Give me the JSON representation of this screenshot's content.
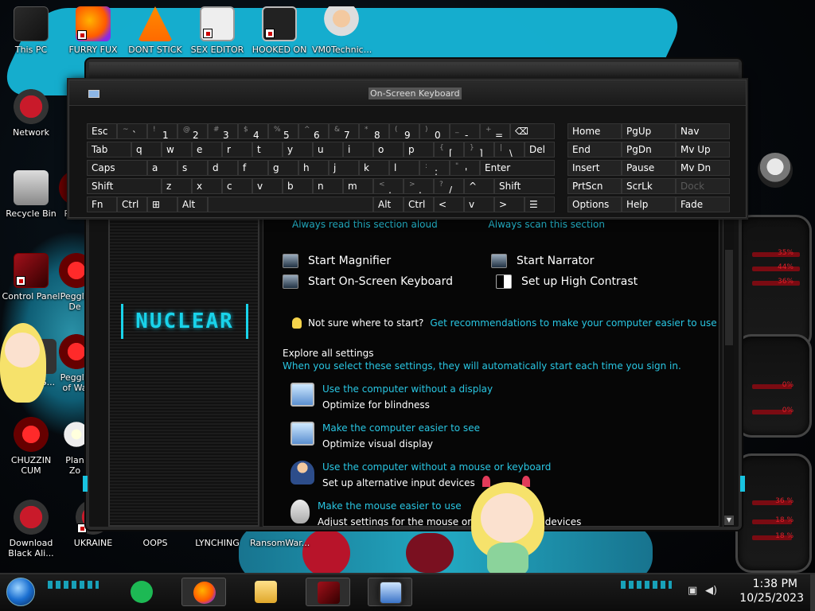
{
  "desktop": {
    "icons": [
      {
        "label": "This PC"
      },
      {
        "label": "FURRY FUX"
      },
      {
        "label": "DONT STICK"
      },
      {
        "label": "SEX EDITOR"
      },
      {
        "label": "HOOKED ON"
      },
      {
        "label": "VM0Technic..."
      },
      {
        "label": "Network"
      },
      {
        "label": "Recycle Bin"
      },
      {
        "label": "Pegg"
      },
      {
        "label": "Control Panel"
      },
      {
        "label": "Peggle De"
      },
      {
        "label": "TS..."
      },
      {
        "label": "Peggle of Wa"
      },
      {
        "label": "CHUZZIN CUM"
      },
      {
        "label": "Plan Zo"
      },
      {
        "label": "Download Black Ali..."
      },
      {
        "label": "UKRAINE"
      },
      {
        "label": "OOPS"
      },
      {
        "label": "LYNCHING"
      },
      {
        "label": "RansomWar..."
      }
    ]
  },
  "hud": {
    "percents": [
      "35%",
      "44%",
      "36%",
      "0%",
      "0%",
      "36 %",
      "18 %",
      "18 %"
    ]
  },
  "ease_window": {
    "logo": "NUCLEAR",
    "checkbox_read": "Always read this section aloud",
    "checkbox_scan": "Always scan this section",
    "quick_tools": {
      "magnifier": "Start Magnifier",
      "narrator": "Start Narrator",
      "osk": "Start On-Screen Keyboard",
      "contrast": "Set up High Contrast"
    },
    "tip_text": "Not sure where to start?",
    "tip_link": "Get recommendations to make your computer easier to use",
    "explore_title": "Explore all settings",
    "explore_sub": "When you select these settings, they will automatically start each time you sign in.",
    "settings": [
      {
        "link": "Use the computer without a display",
        "desc": "Optimize for blindness"
      },
      {
        "link": "Make the computer easier to see",
        "desc": "Optimize visual display"
      },
      {
        "link": "Use the computer without a mouse or keyboard",
        "desc": "Set up alternative input devices"
      },
      {
        "link": "Make the mouse easier to use",
        "desc": "Adjust settings for the mouse or other pointing devices"
      }
    ]
  },
  "osk": {
    "title": "On-Screen Keyboard",
    "rows": {
      "row1": [
        {
          "label": "Esc"
        },
        {
          "sub": "~",
          "main": "`"
        },
        {
          "sub": "!",
          "main": "1"
        },
        {
          "sub": "@",
          "main": "2"
        },
        {
          "sub": "#",
          "main": "3"
        },
        {
          "sub": "$",
          "main": "4"
        },
        {
          "sub": "%",
          "main": "5"
        },
        {
          "sub": "^",
          "main": "6"
        },
        {
          "sub": "&",
          "main": "7"
        },
        {
          "sub": "*",
          "main": "8"
        },
        {
          "sub": "(",
          "main": "9"
        },
        {
          "sub": ")",
          "main": "0"
        },
        {
          "sub": "_",
          "main": "-"
        },
        {
          "sub": "+",
          "main": "="
        },
        {
          "label": "⌫"
        }
      ],
      "row2": [
        {
          "label": "Tab"
        },
        {
          "label": "q"
        },
        {
          "label": "w"
        },
        {
          "label": "e"
        },
        {
          "label": "r"
        },
        {
          "label": "t"
        },
        {
          "label": "y"
        },
        {
          "label": "u"
        },
        {
          "label": "i"
        },
        {
          "label": "o"
        },
        {
          "label": "p"
        },
        {
          "sub": "{",
          "main": "["
        },
        {
          "sub": "}",
          "main": "]"
        },
        {
          "sub": "|",
          "main": "\\"
        },
        {
          "label": "Del"
        }
      ],
      "row3": [
        {
          "label": "Caps"
        },
        {
          "label": "a"
        },
        {
          "label": "s"
        },
        {
          "label": "d"
        },
        {
          "label": "f"
        },
        {
          "label": "g"
        },
        {
          "label": "h"
        },
        {
          "label": "j"
        },
        {
          "label": "k"
        },
        {
          "label": "l"
        },
        {
          "sub": ":",
          "main": ";"
        },
        {
          "sub": "\"",
          "main": "'"
        },
        {
          "label": "Enter"
        }
      ],
      "row4": [
        {
          "label": "Shift"
        },
        {
          "label": "z"
        },
        {
          "label": "x"
        },
        {
          "label": "c"
        },
        {
          "label": "v"
        },
        {
          "label": "b"
        },
        {
          "label": "n"
        },
        {
          "label": "m"
        },
        {
          "sub": "<",
          "main": ","
        },
        {
          "sub": ">",
          "main": "."
        },
        {
          "sub": "?",
          "main": "/"
        },
        {
          "label": "^"
        },
        {
          "label": "Shift"
        }
      ],
      "row5": [
        {
          "label": "Fn"
        },
        {
          "label": "Ctrl"
        },
        {
          "label": "⊞"
        },
        {
          "label": "Alt"
        },
        {
          "label": ""
        },
        {
          "label": "Alt"
        },
        {
          "label": "Ctrl"
        },
        {
          "label": "<"
        },
        {
          "label": "v"
        },
        {
          "label": ">"
        },
        {
          "label": "☰"
        }
      ]
    },
    "nav": [
      [
        "Home",
        "PgUp",
        "Nav"
      ],
      [
        "End",
        "PgDn",
        "Mv Up"
      ],
      [
        "Insert",
        "Pause",
        "Mv Dn"
      ],
      [
        "PrtScn",
        "ScrLk",
        "Dock"
      ],
      [
        "Options",
        "Help",
        "Fade"
      ]
    ]
  },
  "taskbar": {
    "time": "1:38 PM",
    "date": "10/25/2023"
  }
}
